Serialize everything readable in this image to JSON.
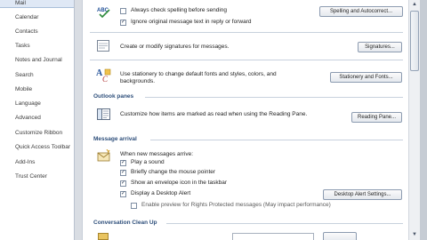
{
  "sidebar": {
    "items": [
      {
        "label": "Mail",
        "selected": true
      },
      {
        "label": "Calendar"
      },
      {
        "label": "Contacts"
      },
      {
        "label": "Tasks"
      },
      {
        "label": "Notes and Journal"
      },
      {
        "label": "Search"
      },
      {
        "label": "Mobile"
      },
      {
        "label": "Language"
      },
      {
        "label": "Advanced"
      },
      {
        "label": "Customize Ribbon"
      },
      {
        "label": "Quick Access Toolbar"
      },
      {
        "label": "Add-Ins"
      },
      {
        "label": "Trust Center"
      }
    ]
  },
  "spelling": {
    "always_check": "Always check spelling before sending",
    "ignore_original": "Ignore original message text in reply or forward",
    "button": "Spelling and Autocorrect..."
  },
  "signatures": {
    "text": "Create or modify signatures for messages.",
    "button": "Signatures..."
  },
  "stationery": {
    "text_line1": "Use stationery to change default fonts and styles, colors, and",
    "text_line2": "backgrounds.",
    "button": "Stationery and Fonts..."
  },
  "outlook_panes": {
    "title": "Outlook panes",
    "text": "Customize how items are marked as read when using the Reading Pane.",
    "button": "Reading Pane..."
  },
  "message_arrival": {
    "title": "Message arrival",
    "when_new": "When new messages arrive:",
    "play_sound": "Play a sound",
    "change_pointer": "Briefly change the mouse pointer",
    "envelope_icon": "Show an envelope icon in the taskbar",
    "desktop_alert": "Display a Desktop Alert",
    "rights_preview": "Enable preview for Rights Protected messages (May impact performance)",
    "button": "Desktop Alert Settings..."
  },
  "cleanup": {
    "title": "Conversation Clean Up"
  },
  "scrollbar": {
    "up": "▲",
    "down": "▼"
  },
  "icons": {
    "spelling": "spelling-abc-icon",
    "signature": "signature-icon",
    "stationery": "stationery-icon",
    "reading_pane": "reading-pane-icon",
    "message_arrival": "envelope-arrival-icon"
  }
}
